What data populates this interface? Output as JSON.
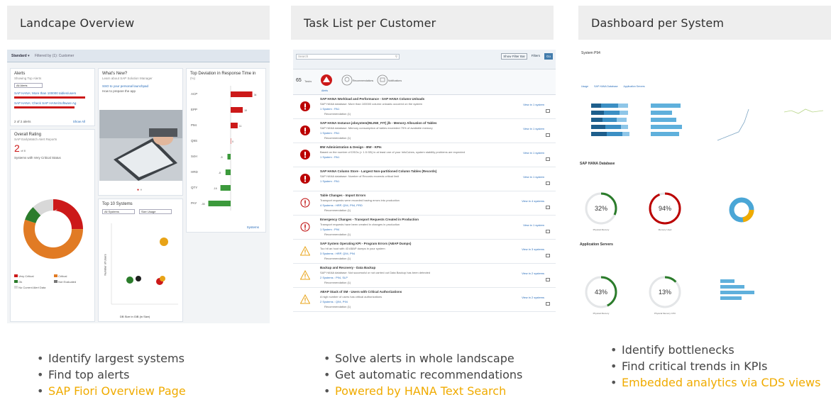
{
  "columns": [
    {
      "title": "Landcape Overview",
      "bullets": [
        "Identify largest systems",
        "Find top alerts"
      ],
      "link": "SAP Fiori Overview Page",
      "shot": {
        "bar_title": "Standard",
        "bar_filter": "Filtered by (1): Customer",
        "alerts": {
          "title": "Alerts",
          "subtitle": "Showing Top Alerts",
          "select": "All Alerts",
          "rows": [
            "SAP HANA: More than 100000 tables/users",
            "SAP HANA: Check SAP HANA/Software Ag"
          ],
          "footer": "2 of 2 alerts",
          "show_all": "Show All"
        },
        "whats_new": {
          "title": "What's New?",
          "subtitle": "Learn about SAP Solution Manager",
          "link": "SSO to your personal launchpad",
          "text": "How to prepare the app"
        },
        "top_dev": {
          "title": "Top Deviation in Response Time in",
          "unit": "(%)",
          "categories": [
            "ACP",
            "EPP",
            "P94",
            "Q9S",
            "S4H",
            "HRD",
            "QTY",
            "PAY"
          ],
          "values": [
            34,
            19,
            11,
            0,
            -5,
            -8,
            -16,
            -35
          ],
          "footer": "Systems"
        },
        "overall": {
          "title": "Overall Rating",
          "subtitle": "SAP EarlyWatch Alert Reports",
          "big": "2",
          "big_suffix": "of 8",
          "caption": "Systems with Very Critical Status",
          "donut": [
            {
              "label": "Very Critical",
              "value": 25,
              "color": "#cc1919"
            },
            {
              "label": "Critical",
              "value": 55,
              "color": "#e17b24"
            },
            {
              "label": "Ok",
              "value": 8,
              "color": "#2b7c2b"
            },
            {
              "label": "Not Evaluated",
              "value": 12,
              "color": "#d8d8d8"
            }
          ],
          "legend": [
            "Very Critical",
            "Critical",
            "Ok",
            "Not Evaluated",
            "No Current Alert Data"
          ]
        },
        "top10": {
          "title": "Top 10 Systems",
          "select1": "All Systems",
          "select2": "Size Usage",
          "ylabel": "Number of Users",
          "xlabel": "DB Size in GiB (in Size)"
        }
      }
    },
    {
      "title": "Task List per Customer",
      "bullets": [
        "Solve alerts in whole landscape",
        "Get automatic recommendations"
      ],
      "link": "Powered by HANA Text Search",
      "shot": {
        "search": "Search",
        "filter": "Show Filter Bar",
        "filter2": "Filters",
        "go": "Go",
        "count": "65",
        "count_label": "Tasks",
        "head_icons": [
          "Alerts",
          "Recommendations",
          "Notifications"
        ],
        "tasks": [
          {
            "sev": "alert",
            "title": "SAP HANA Workload and Performance - SAP HANA Column Unloads",
            "desc": "SAP HANA database: More than 100000 column unloads occurred on the system",
            "sys": "1 System : PA1",
            "rec": "Recommendation (1)",
            "link": "View in 1 system"
          },
          {
            "sev": "alert",
            "title": "SAP HANA Instance jobsystem(INLINE_FIT) j/b - Memory Allocation of Tables",
            "desc": "SAP HANA database: Memory consumption of tables exceeded 75% of available memory",
            "sys": "1 System : PA1",
            "rec": "Recommendation (1)",
            "link": "View in 1 system"
          },
          {
            "sev": "alert",
            "title": "BW Administration & Design - BW - KPIs",
            "desc": "Based on the number of DSOs (> 1.5 GB) in at least one of your InfoCubes, system stability problems are expected",
            "sys": "1 System : PA1",
            "rec": "",
            "link": "View in 1 system"
          },
          {
            "sev": "alert",
            "title": "SAP HANA Column Store - Largest Non-partitioned Column Tables (Records)",
            "desc": "SAP HANA database: Number of Records exceeds critical limit",
            "sys": "1 System : PA1",
            "rec": "",
            "link": "View in 1 system"
          },
          {
            "sev": "warn",
            "title": "Table Changes - Import Errors",
            "desc": "Transport requests were recorded having errors into production",
            "sys": "4 Systems : HRP, Q94, P94, PRD",
            "rec": "Recommendation (1)",
            "link": "View in 4 systems"
          },
          {
            "sev": "warn",
            "title": "Emergency Changes - Transport Requests Created in Production",
            "desc": "Transport requests have been created in changes in production",
            "sys": "1 System : P94",
            "rec": "Recommendation (1)",
            "link": "View in 1 system"
          },
          {
            "sev": "tri",
            "title": "SAP System Operating KPI - Program Errors (ABAP Dumps)",
            "desc": "Too hit an hoot with 43 ABAP dumps in your system",
            "sys": "3 Systems : HRP, Q94, P94",
            "rec": "Recommendation (1)",
            "link": "View in 3 systems"
          },
          {
            "sev": "tri",
            "title": "Backup and Recovery - Data Backup",
            "desc": "SAP HANA database: Not successful or not carried out Data Backup has been detected",
            "sys": "2 Systems : P94, SLP",
            "rec": "Recommendation (1)",
            "link": "View in 2 systems"
          },
          {
            "sev": "tri",
            "title": "ABAP Stack of SM - Users with Critical Authorizations",
            "desc": "A high number of users has critical authorizations",
            "sys": "2 Systems : Q94, P94",
            "rec": "Recommendation (1)",
            "link": "View in 2 systems"
          }
        ]
      }
    },
    {
      "title": "Dashboard per System",
      "bullets": [
        "Identify bottlenecks",
        "Find critical trends in KPIs"
      ],
      "link": "Embedded analytics via CDS views",
      "shot": {
        "sys_title": "System P94",
        "tabs": [
          "Usage",
          "SAP HANA Database",
          "Application Servers"
        ],
        "sec1": "SAP HANA Database",
        "sec2": "Application Servers",
        "gauges": [
          {
            "label": "32%",
            "value": 32,
            "color": "#2b7c2b"
          },
          {
            "label": "94%",
            "value": 94,
            "color": "#bb0000"
          },
          {
            "label": "43%",
            "value": 43,
            "color": "#2b7c2b"
          },
          {
            "label": "13%",
            "value": 13,
            "color": "#2b7c2b"
          }
        ],
        "gauge_caps": [
          "Physical Memory",
          "Memory Used",
          "Physical Memory",
          "Physical Memory CPU"
        ]
      }
    }
  ]
}
